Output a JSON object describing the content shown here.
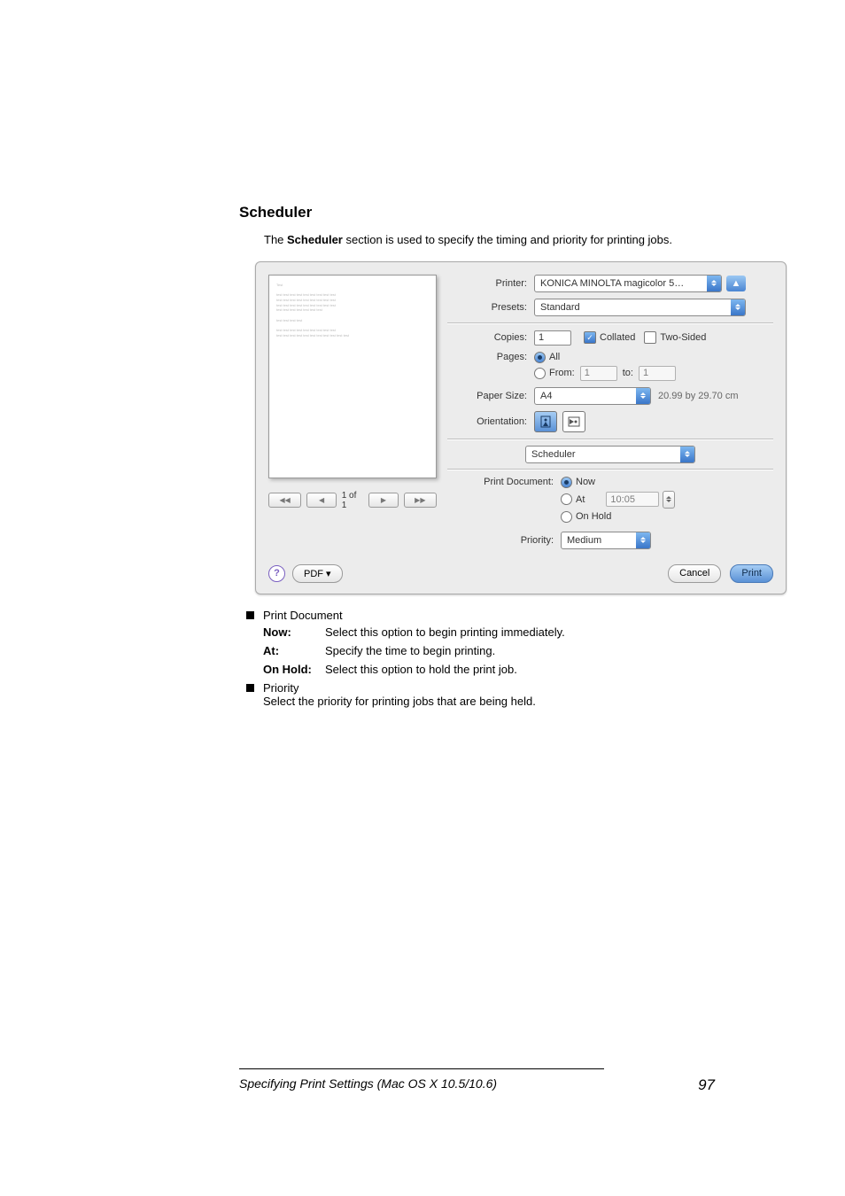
{
  "heading": "Scheduler",
  "intro": "The Scheduler section is used to specify the timing and priority for printing jobs.",
  "labels": {
    "printer": "Printer:",
    "presets": "Presets:",
    "copies": "Copies:",
    "pages": "Pages:",
    "from": "From:",
    "to": "to:",
    "paperSize": "Paper Size:",
    "orientation": "Orientation:",
    "printDocument": "Print Document:",
    "priority": "Priority:"
  },
  "values": {
    "printer": "KONICA MINOLTA magicolor 5…",
    "presets": "Standard",
    "copies": "1",
    "collated": "Collated",
    "twoSided": "Two-Sided",
    "pagesAll": "All",
    "from": "1",
    "to": "1",
    "paperSize": "A4",
    "paperDim": "20.99 by 29.70 cm",
    "panel": "Scheduler",
    "now": "Now",
    "at": "At",
    "atTime": "10:05",
    "onHold": "On Hold",
    "priority": "Medium"
  },
  "nav": {
    "page": "1 of 1"
  },
  "buttons": {
    "pdf": "PDF ▾",
    "cancel": "Cancel",
    "print": "Print"
  },
  "desc": {
    "printDocument": "Print Document",
    "now": {
      "k": "Now:",
      "v": "Select this option to begin printing immediately."
    },
    "at": {
      "k": "At:",
      "v": "Specify the time to begin printing."
    },
    "onHold": {
      "k": "On Hold:",
      "v": "Select this option to hold the print job."
    },
    "priority": "Priority",
    "priorityText": "Select the priority for printing jobs that are being held."
  },
  "footer": {
    "title": "Specifying Print Settings (Mac OS X 10.5/10.6)",
    "page": "97"
  }
}
